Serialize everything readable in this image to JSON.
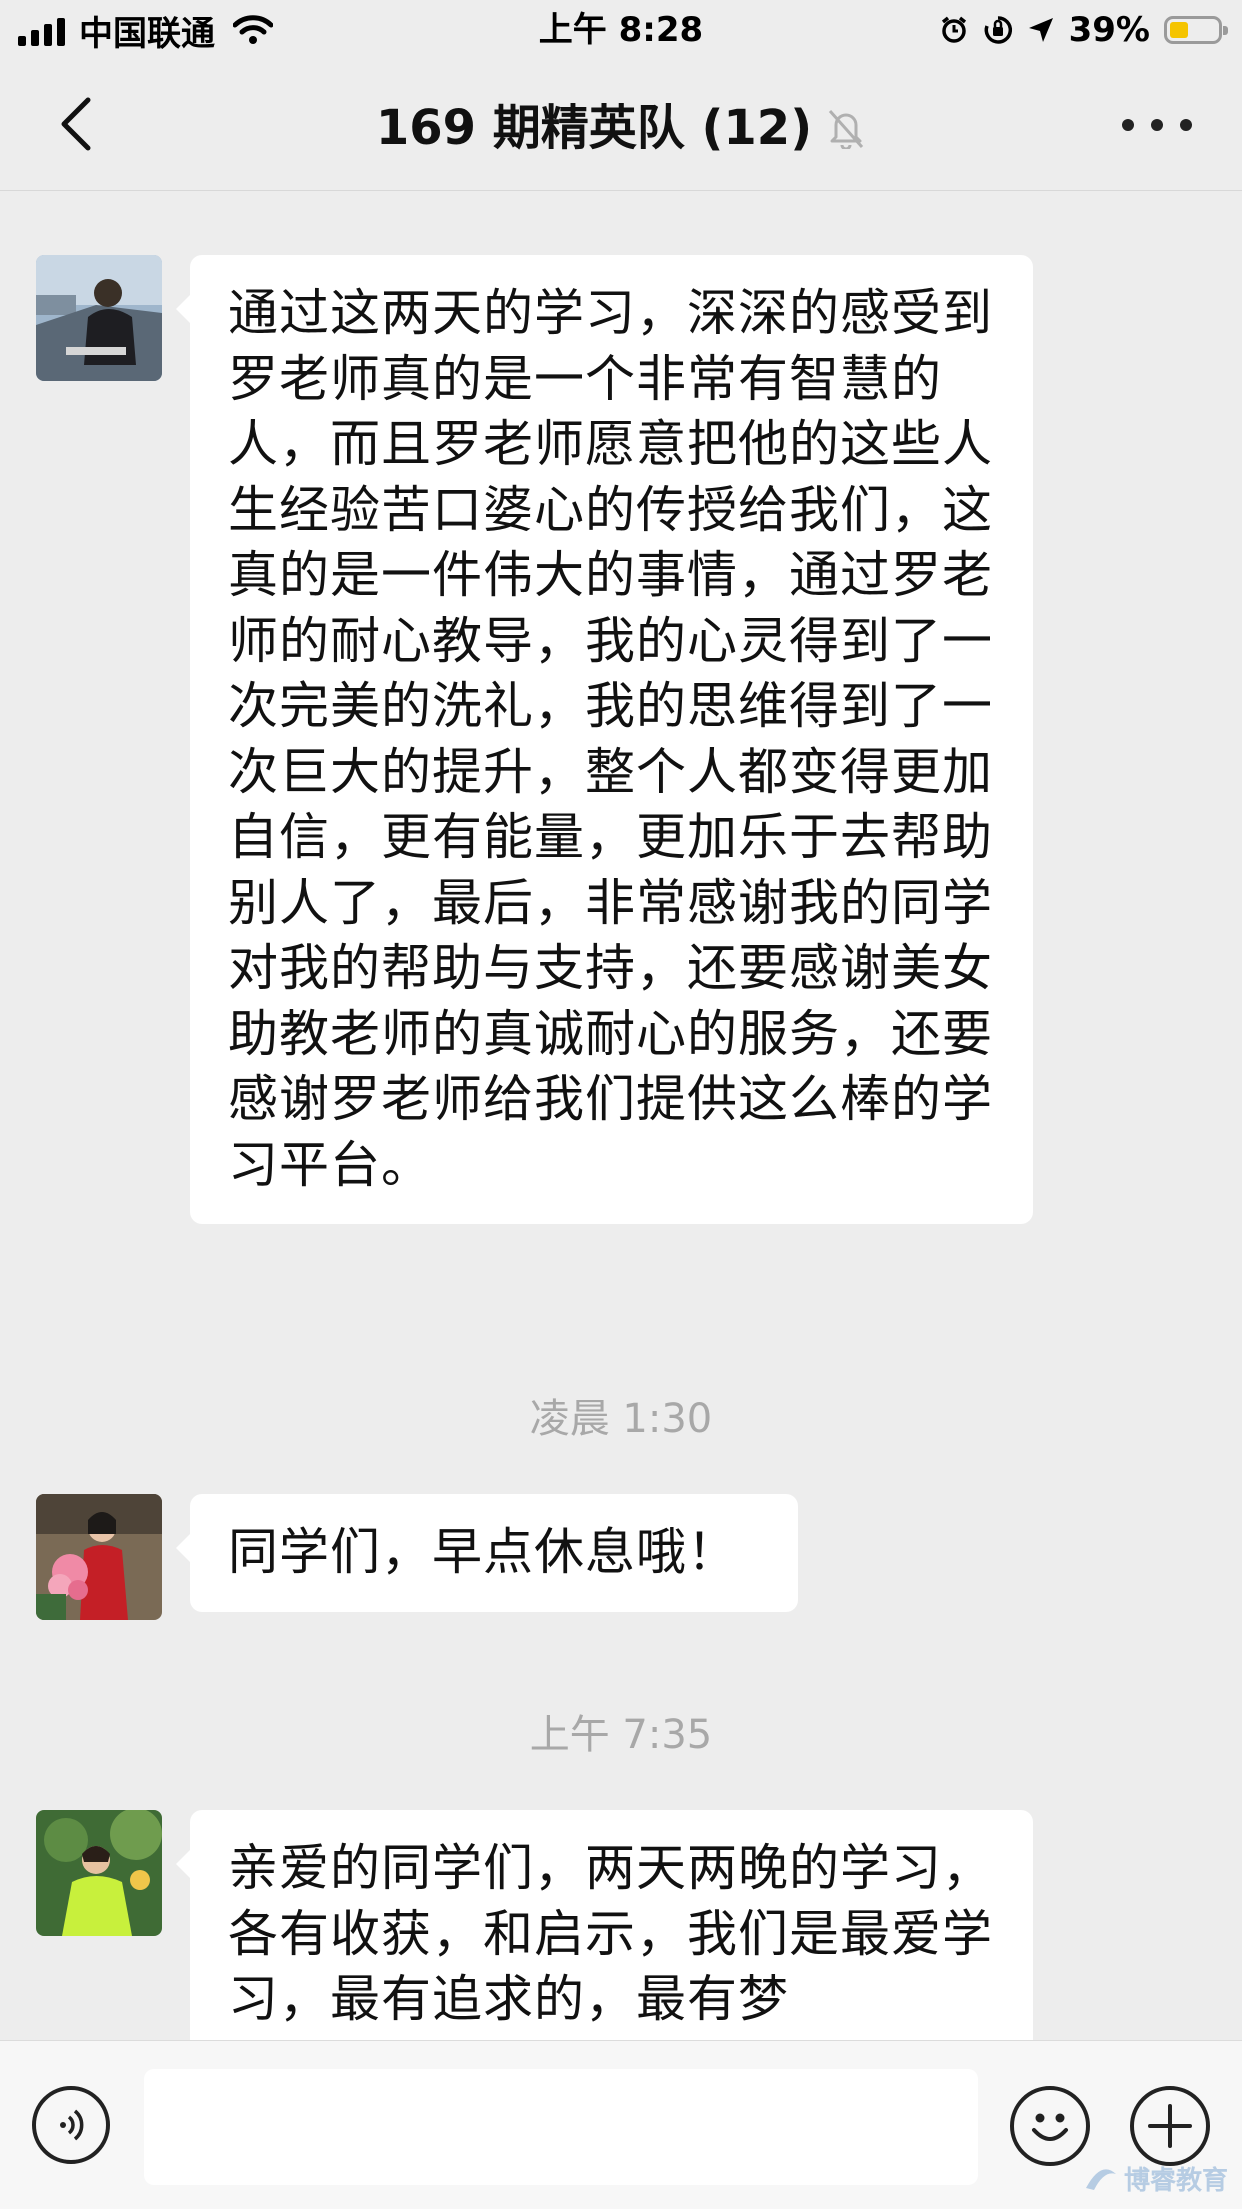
{
  "status_bar": {
    "carrier": "中国联通",
    "time": "上午 8:28",
    "battery_percent": "39%",
    "battery_level": 0.39,
    "icons": [
      "signal-icon",
      "wifi-icon",
      "alarm-icon",
      "orientation-lock-icon",
      "location-icon",
      "battery-icon"
    ]
  },
  "nav": {
    "title": "169 期精英队 (12)",
    "back_icon": "chevron-left-icon",
    "mute_icon": "bell-off-icon",
    "more_icon": "more-dots-icon"
  },
  "messages": [
    {
      "avatar": "avatar-man-laptop",
      "text": "通过这两天的学习，深深的感受到罗老师真的是一个非常有智慧的人，而且罗老师愿意把他的这些人生经验苦口婆心的传授给我们，这真的是一件伟大的事情，通过罗老师的耐心教导，我的心灵得到了一次完美的洗礼，我的思维得到了一次巨大的提升，整个人都变得更加自信，更有能量，更加乐于去帮助别人了，最后，非常感谢我的同学对我的帮助与支持，还要感谢美女助教老师的真诚耐心的服务，还要感谢罗老师给我们提供这么棒的学习平台。"
    },
    {
      "timestamp": "凌晨 1:30",
      "avatar": "avatar-woman-flowers",
      "text": "同学们，早点休息哦！"
    },
    {
      "timestamp": "上午 7:35",
      "avatar": "avatar-woman-green",
      "text": "亲爱的同学们，两天两晚的学习，各有收获，和启示，我们是最爱学习，最有追求的，最有梦"
    }
  ],
  "input_bar": {
    "placeholder": "",
    "voice_icon": "voice-icon",
    "emoji_icon": "emoji-icon",
    "plus_icon": "plus-icon"
  },
  "watermark": {
    "text": "博睿教育"
  },
  "colors": {
    "background": "#ededed",
    "bubble": "#ffffff",
    "timestamp": "#a8a8a8",
    "battery": "#f5c400"
  }
}
